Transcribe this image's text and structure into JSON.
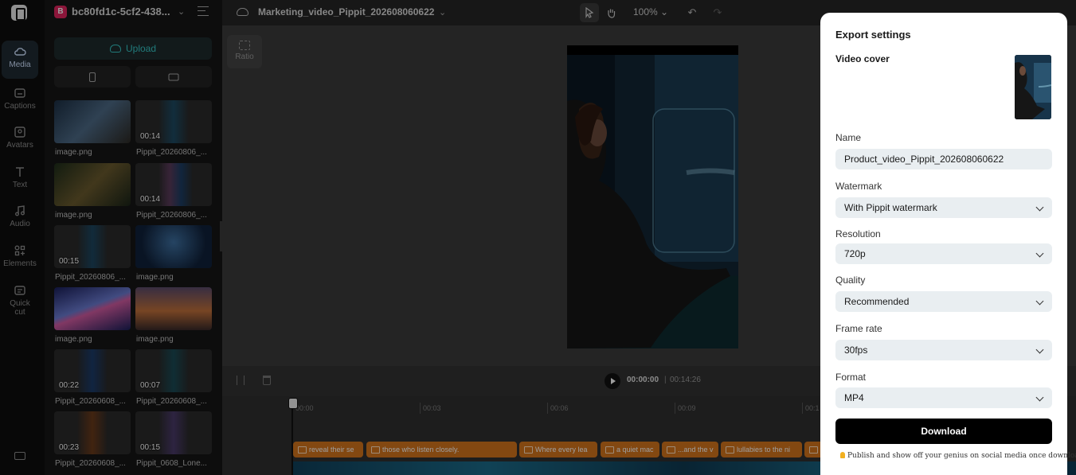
{
  "rail": {
    "items": [
      {
        "label": "Media",
        "icon": "cloud-icon"
      },
      {
        "label": "Captions",
        "icon": "captions-icon"
      },
      {
        "label": "Avatars",
        "icon": "avatar-icon"
      },
      {
        "label": "Text",
        "icon": "text-icon"
      },
      {
        "label": "Audio",
        "icon": "music-icon"
      },
      {
        "label": "Elements",
        "icon": "elements-icon"
      },
      {
        "label": "Quick",
        "label2": "cut",
        "icon": "quick-cut-icon"
      }
    ]
  },
  "panel": {
    "project_initial": "B",
    "project_name": "bc80fd1c-5cf2-438...",
    "upload_label": "Upload",
    "media": [
      {
        "label": "image.png",
        "duration": ""
      },
      {
        "label": "Pippit_20260806_...",
        "duration": "00:14"
      },
      {
        "label": "image.png",
        "duration": ""
      },
      {
        "label": "Pippit_20260806_...",
        "duration": "00:14"
      },
      {
        "label": "Pippit_20260806_...",
        "duration": "00:15"
      },
      {
        "label": "image.png",
        "duration": ""
      },
      {
        "label": "image.png",
        "duration": ""
      },
      {
        "label": "image.png",
        "duration": ""
      },
      {
        "label": "Pippit_20260608_...",
        "duration": "00:22"
      },
      {
        "label": "Pippit_20260608_...",
        "duration": "00:07"
      },
      {
        "label": "Pippit_20260608_...",
        "duration": "00:23"
      },
      {
        "label": "Pippit_0608_Lone...",
        "duration": "00:15"
      }
    ]
  },
  "topbar": {
    "title": "Marketing_video_Pippit_202608060622",
    "zoom": "100%"
  },
  "canvas": {
    "ratio_label": "Ratio"
  },
  "playback": {
    "current": "00:00:00",
    "separator": "|",
    "total": "00:14:26"
  },
  "timeline": {
    "ticks": [
      "00:00",
      "00:03",
      "00:06",
      "00:09",
      "00:1"
    ],
    "clips": [
      "reveal their se",
      "those who listen closely.",
      "Where every lea",
      "a quiet mac",
      "...and the v",
      "lullabies to the ni",
      ""
    ]
  },
  "export": {
    "title": "Export settings",
    "cover_label": "Video cover",
    "name_label": "Name",
    "name_value": "Product_video_Pippit_202608060622",
    "watermark_label": "Watermark",
    "watermark_value": "With Pippit watermark",
    "resolution_label": "Resolution",
    "resolution_value": "720p",
    "quality_label": "Quality",
    "quality_value": "Recommended",
    "framerate_label": "Frame rate",
    "framerate_value": "30fps",
    "format_label": "Format",
    "format_value": "MP4",
    "download_label": "Download",
    "tip": "Publish and show off your genius on social media once downloaded."
  }
}
